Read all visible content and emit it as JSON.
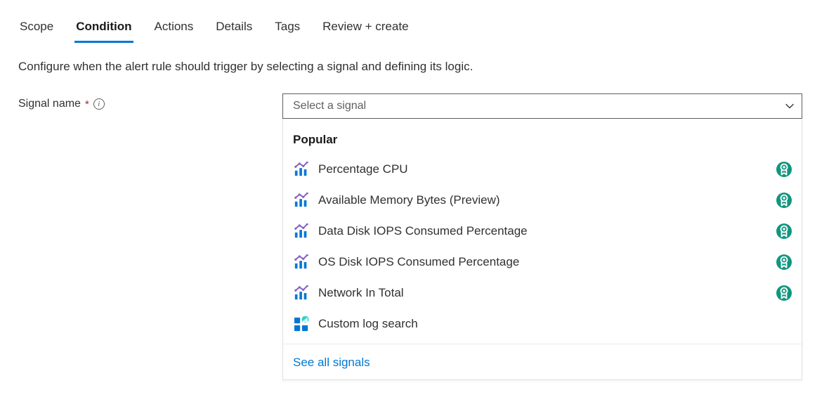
{
  "tabs": [
    {
      "label": "Scope",
      "name": "scope",
      "active": false
    },
    {
      "label": "Condition",
      "name": "condition",
      "active": true
    },
    {
      "label": "Actions",
      "name": "actions",
      "active": false
    },
    {
      "label": "Details",
      "name": "details",
      "active": false
    },
    {
      "label": "Tags",
      "name": "tags",
      "active": false
    },
    {
      "label": "Review + create",
      "name": "review-create",
      "active": false
    }
  ],
  "description": "Configure when the alert rule should trigger by selecting a signal and defining its logic.",
  "field": {
    "label": "Signal name",
    "placeholder": "Select a signal"
  },
  "dropdown": {
    "section_header": "Popular",
    "items": [
      {
        "label": "Percentage CPU",
        "icon": "metric",
        "badge": true
      },
      {
        "label": "Available Memory Bytes (Preview)",
        "icon": "metric",
        "badge": true
      },
      {
        "label": "Data Disk IOPS Consumed Percentage",
        "icon": "metric",
        "badge": true
      },
      {
        "label": "OS Disk IOPS Consumed Percentage",
        "icon": "metric",
        "badge": true
      },
      {
        "label": "Network In Total",
        "icon": "metric",
        "badge": true
      },
      {
        "label": "Custom log search",
        "icon": "log",
        "badge": false
      }
    ],
    "see_all_label": "See all signals"
  }
}
